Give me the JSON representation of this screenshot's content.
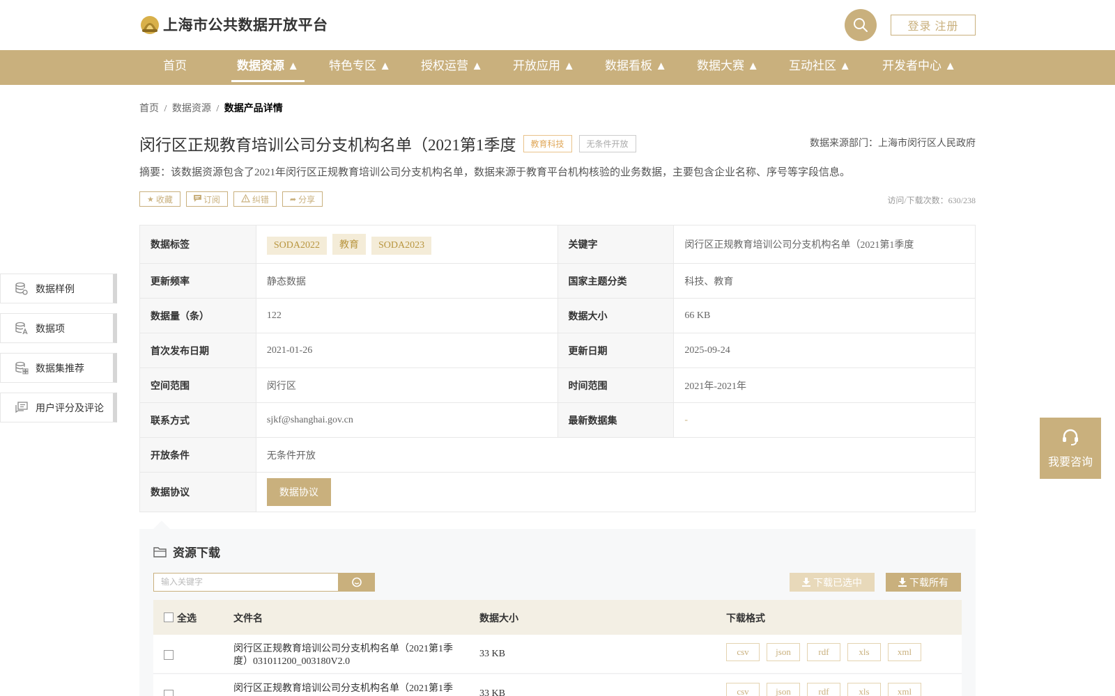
{
  "header": {
    "logo_text": "上海市公共数据开放平台",
    "login_label": "登录 注册"
  },
  "nav": {
    "items": [
      {
        "label": "首页"
      },
      {
        "label": "数据资源 ▲"
      },
      {
        "label": "特色专区 ▲"
      },
      {
        "label": "授权运营 ▲"
      },
      {
        "label": "开放应用 ▲"
      },
      {
        "label": "数据看板 ▲"
      },
      {
        "label": "数据大赛 ▲"
      },
      {
        "label": "互动社区 ▲"
      },
      {
        "label": "开发者中心 ▲"
      }
    ],
    "active_index": 1
  },
  "breadcrumb": {
    "home": "首页",
    "sep": "/",
    "resources": "数据资源",
    "current": "数据产品详情"
  },
  "dataset": {
    "title": "闵行区正规教育培训公司分支机构名单（2021第1季度",
    "tag_category": "教育科技",
    "tag_open": "无条件开放",
    "source_dept": "数据来源部门：上海市闵行区人民政府",
    "summary": "摘要：该数据资源包含了2021年闵行区正规教育培训公司分支机构名单，数据来源于教育平台机构核验的业务数据，主要包含企业名称、序号等字段信息。",
    "visits": "访问/下载次数：630/238"
  },
  "actions": {
    "collect": "收藏",
    "subscribe": "订阅",
    "correct": "纠错",
    "share": "分享"
  },
  "info": {
    "tags_label": "数据标签",
    "tags": [
      "SODA2022",
      "教育",
      "SODA2023"
    ],
    "keyword_label": "关键字",
    "keyword": "闵行区正规教育培训公司分支机构名单（2021第1季度",
    "freq_label": "更新频率",
    "freq": "静态数据",
    "theme_label": "国家主题分类",
    "theme": "科技、教育",
    "count_label": "数据量（条）",
    "count": "122",
    "size_label": "数据大小",
    "size": "66 KB",
    "first_pub_label": "首次发布日期",
    "first_pub": "2021-01-26",
    "updated_label": "更新日期",
    "updated": "2025-09-24",
    "space_label": "空间范围",
    "space": "闵行区",
    "time_label": "时间范围",
    "time": "2021年-2021年",
    "contact_label": "联系方式",
    "contact": "sjkf@shanghai.gov.cn",
    "latest_label": "最新数据集",
    "latest": "-",
    "open_label": "开放条件",
    "open": "无条件开放",
    "agreement_label": "数据协议",
    "agreement_btn": "数据协议"
  },
  "side_menu": {
    "sample": "数据样例",
    "items": "数据项",
    "recommend": "数据集推荐",
    "comments": "用户评分及评论"
  },
  "consult": {
    "label": "我要咨询"
  },
  "download": {
    "title": "资源下载",
    "search_placeholder": "输入关键字",
    "download_selected": "下载已选中",
    "download_all": "下载所有",
    "col_select_all": "全选",
    "col_filename": "文件名",
    "col_size": "数据大小",
    "col_format": "下载格式",
    "rows": [
      {
        "name": "闵行区正规教育培训公司分支机构名单（2021第1季度）031011200_003180V2.0",
        "size": "33 KB",
        "formats": [
          "csv",
          "json",
          "rdf",
          "xls",
          "xml"
        ]
      },
      {
        "name": "闵行区正规教育培训公司分支机构名单（2021第1季",
        "size": "33 KB",
        "formats": [
          "csv",
          "json",
          "rdf",
          "xls",
          "xml"
        ]
      }
    ]
  },
  "colors": {
    "brand": "#c9b07d",
    "brand_light": "#f4ecd8",
    "tag_orange": "#e0a85a"
  }
}
